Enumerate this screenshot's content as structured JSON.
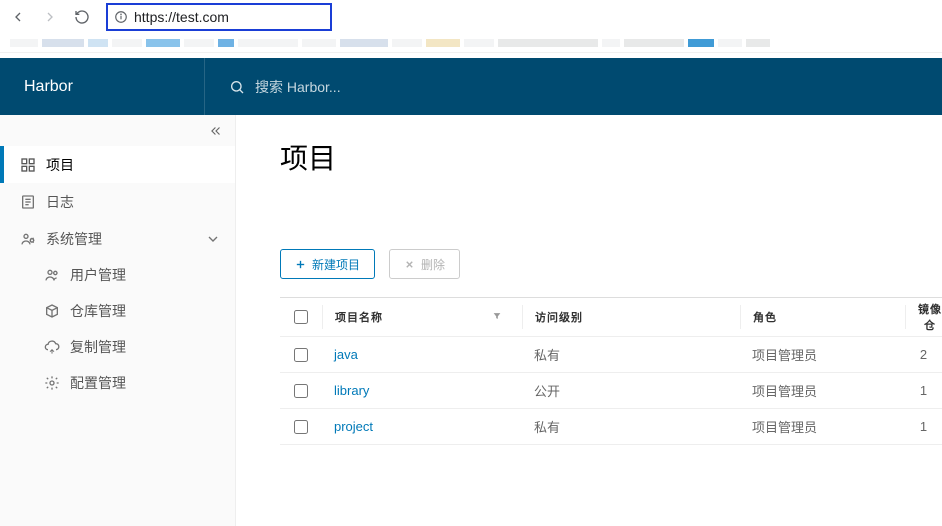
{
  "browser": {
    "url": "https://test.com"
  },
  "header": {
    "brand": "Harbor",
    "search_placeholder": "搜索 Harbor..."
  },
  "sidebar": {
    "items": [
      {
        "label": "项目",
        "active": true
      },
      {
        "label": "日志"
      },
      {
        "label": "系统管理",
        "expandable": true,
        "expanded": true
      }
    ],
    "subitems": [
      {
        "label": "用户管理"
      },
      {
        "label": "仓库管理"
      },
      {
        "label": "复制管理"
      },
      {
        "label": "配置管理"
      }
    ]
  },
  "page": {
    "title": "项目",
    "toolbar": {
      "new_label": "新建项目",
      "delete_label": "删除"
    },
    "columns": {
      "name": "项目名称",
      "access": "访问级别",
      "role": "角色",
      "repo": "镜像仓"
    },
    "rows": [
      {
        "name": "java",
        "access": "私有",
        "role": "项目管理员",
        "repo": "2"
      },
      {
        "name": "library",
        "access": "公开",
        "role": "项目管理员",
        "repo": "1"
      },
      {
        "name": "project",
        "access": "私有",
        "role": "项目管理员",
        "repo": "1"
      }
    ]
  }
}
